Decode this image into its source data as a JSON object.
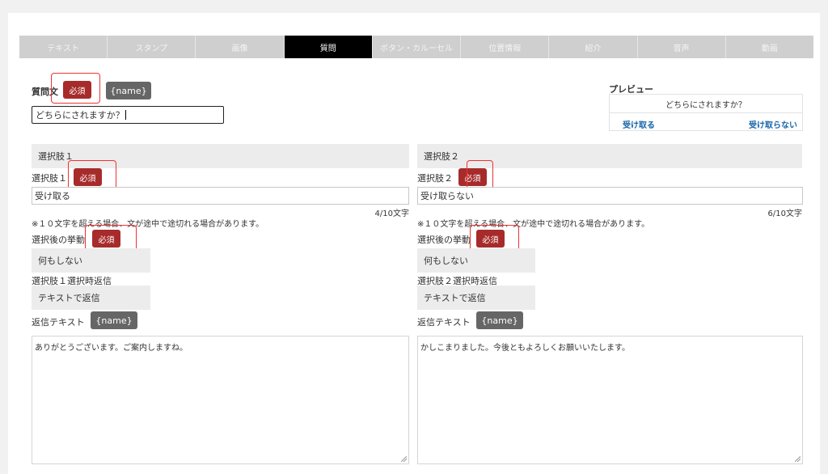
{
  "tabs": [
    {
      "label": "テキスト"
    },
    {
      "label": "スタンプ"
    },
    {
      "label": "画像"
    },
    {
      "label": "質問"
    },
    {
      "label": "ボタン・カルーセル"
    },
    {
      "label": "位置情報"
    },
    {
      "label": "紹介"
    },
    {
      "label": "音声"
    },
    {
      "label": "動画"
    }
  ],
  "active_tab": "質問",
  "question": {
    "label": "質問文",
    "required": "必須",
    "name_button": "{name}",
    "value": "どちらにされますか？"
  },
  "preview": {
    "title": "プレビュー",
    "question": "どちらにされますか？",
    "option1": "受け取る",
    "option2": "受け取らない"
  },
  "choices": [
    {
      "header": "選択肢１",
      "label": "選択肢１",
      "required": "必須",
      "value": "受け取る",
      "counter": "4/10文字",
      "note": "※１０文字を超える場合、文が途中で途切れる場合があります。",
      "action_label": "選択後の挙動",
      "action_required": "必須",
      "action_value": "何もしない",
      "reply_label": "選択肢１選択時返信",
      "reply_value": "テキストで返信",
      "reply_text_label": "返信テキスト",
      "name_button": "{name}",
      "reply_text": "ありがとうございます。ご案内しますね。"
    },
    {
      "header": "選択肢２",
      "label": "選択肢２",
      "required": "必須",
      "value": "受け取らない",
      "counter": "6/10文字",
      "note": "※１０文字を超える場合、文が途中で途切れる場合があります。",
      "action_label": "選択後の挙動",
      "action_required": "必須",
      "action_value": "何もしない",
      "reply_label": "選択肢２選択時返信",
      "reply_value": "テキストで返信",
      "reply_text_label": "返信テキスト",
      "name_button": "{name}",
      "reply_text": "かしこまりました。今後ともよろしくお願いいたします。"
    }
  ],
  "colors": {
    "required_badge": "#a72b2b",
    "highlight": "#e33333",
    "active_tab": "#000000",
    "link": "#1565a8"
  }
}
